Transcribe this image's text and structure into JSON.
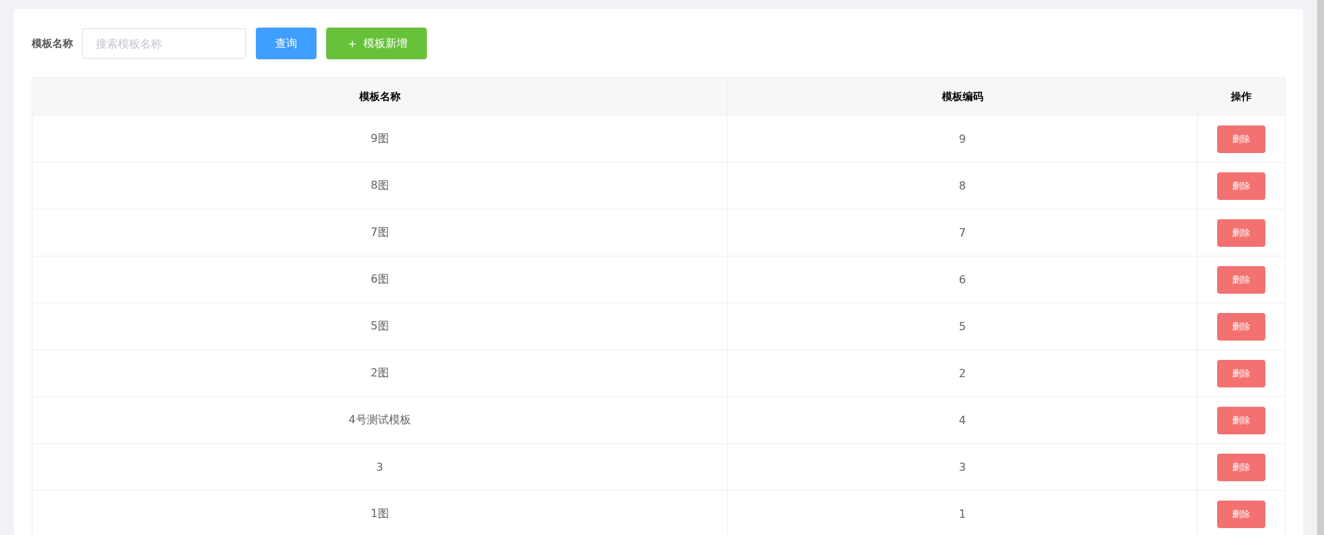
{
  "search": {
    "label": "模板名称",
    "placeholder": "搜索模板名称",
    "query_button": "查询",
    "add_button": {
      "icon": "＋",
      "label": "模板新增"
    }
  },
  "table": {
    "columns": [
      "模板名称",
      "模板编码",
      "操作"
    ],
    "rows": [
      {
        "name": "9图",
        "code": "9",
        "action": "删除"
      },
      {
        "name": "8图",
        "code": "8",
        "action": "删除"
      },
      {
        "name": "7图",
        "code": "7",
        "action": "删除"
      },
      {
        "name": "6图",
        "code": "6",
        "action": "删除"
      },
      {
        "name": "5图",
        "code": "5",
        "action": "删除"
      },
      {
        "name": "2图",
        "code": "2",
        "action": "删除"
      },
      {
        "name": "4号测试模板",
        "code": "4",
        "action": "删除"
      },
      {
        "name": "3",
        "code": "3",
        "action": "删除"
      },
      {
        "name": "1图",
        "code": "1",
        "action": "删除"
      }
    ]
  }
}
